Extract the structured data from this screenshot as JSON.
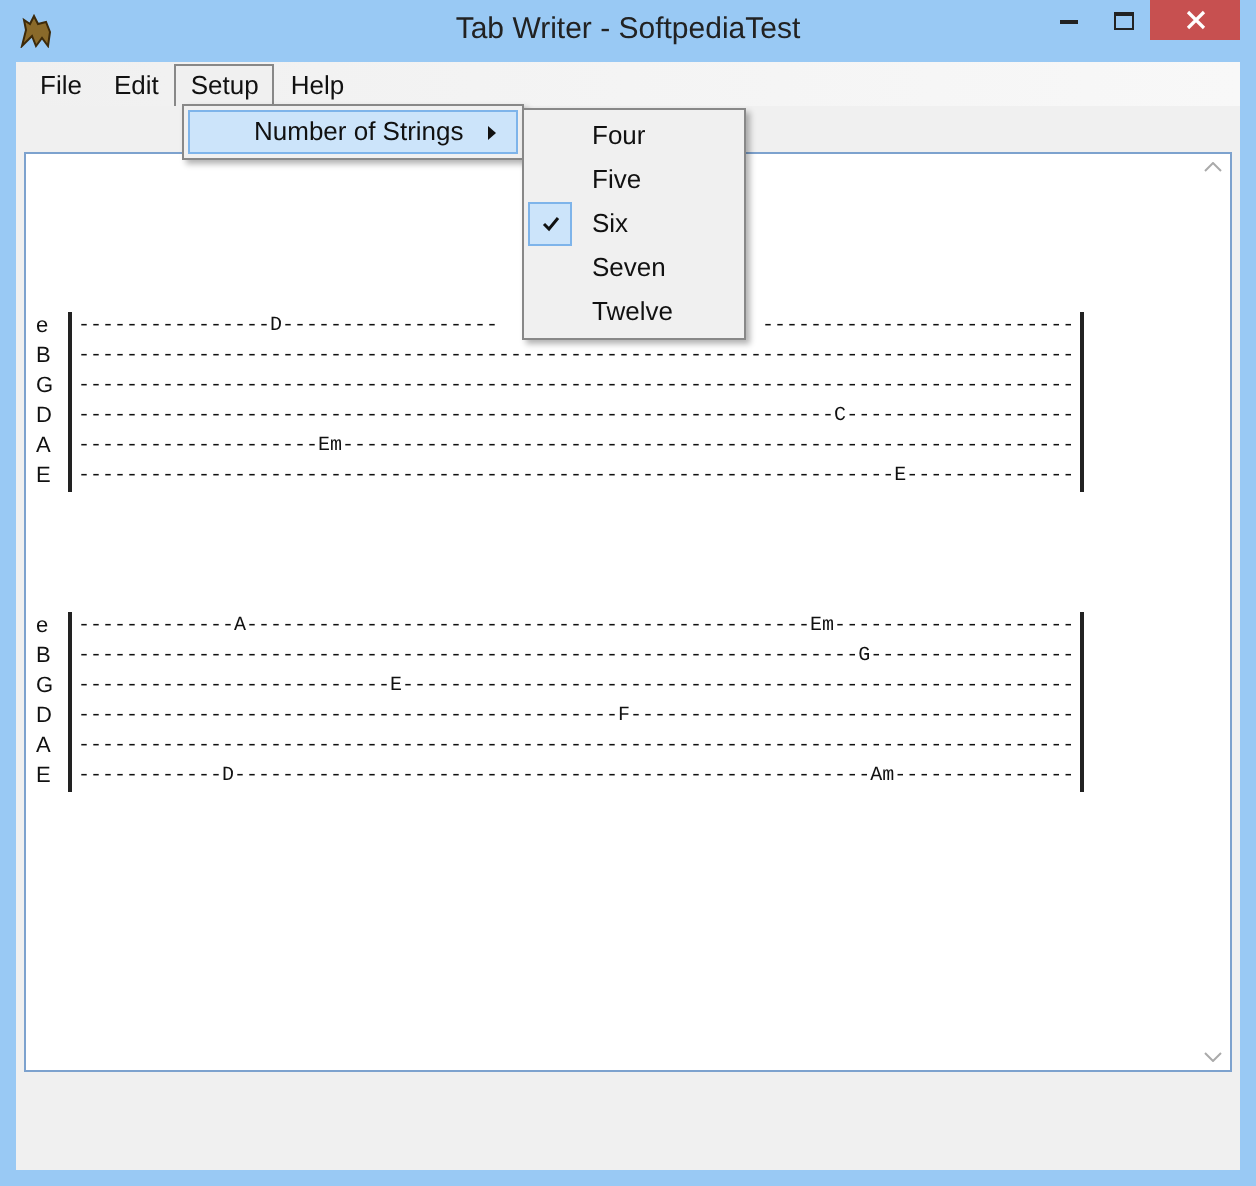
{
  "window": {
    "title": "Tab Writer - SoftpediaTest"
  },
  "menu": [
    {
      "label": "File",
      "selected": false
    },
    {
      "label": "Edit",
      "selected": false
    },
    {
      "label": "Setup",
      "selected": true
    },
    {
      "label": "Help",
      "selected": false
    }
  ],
  "setup_menu": [
    {
      "label": "Number of Strings",
      "selected": true
    }
  ],
  "strings_submenu": [
    {
      "label": "Four",
      "checked": false
    },
    {
      "label": "Five",
      "checked": false
    },
    {
      "label": "Six",
      "checked": true
    },
    {
      "label": "Seven",
      "checked": false
    },
    {
      "label": "Twelve",
      "checked": false
    }
  ],
  "tab_blocks": [
    {
      "lines": [
        {
          "string": "e",
          "notes": [
            "----------------D------------------",
            "--------------------------"
          ]
        },
        {
          "string": "B",
          "notes": "-----------------------------------------------------------------------------------"
        },
        {
          "string": "G",
          "notes": "-----------------------------------------------------------------------------------"
        },
        {
          "string": "D",
          "notes": "---------------------------------------------------------------C-------------------"
        },
        {
          "string": "A",
          "notes": "--------------------Em-------------------------------------------------------------"
        },
        {
          "string": "E",
          "notes": "--------------------------------------------------------------------E--------------"
        }
      ]
    },
    {
      "lines": [
        {
          "string": "e",
          "notes": "-------------A-----------------------------------------------Em--------------------"
        },
        {
          "string": "B",
          "notes": "-----------------------------------------------------------------G-----------------"
        },
        {
          "string": "G",
          "notes": "--------------------------E--------------------------------------------------------"
        },
        {
          "string": "D",
          "notes": "---------------------------------------------F-------------------------------------"
        },
        {
          "string": "A",
          "notes": "-----------------------------------------------------------------------------------"
        },
        {
          "string": "E",
          "notes": "------------D-----------------------------------------------------Am---------------"
        }
      ]
    }
  ]
}
